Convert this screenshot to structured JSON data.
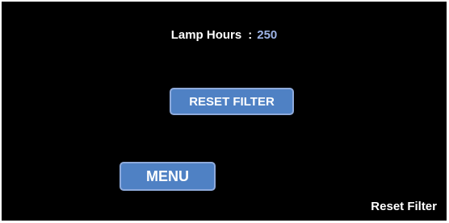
{
  "status": {
    "lamp_hours_label": "Lamp Hours",
    "separator": ":",
    "lamp_hours_value": "250"
  },
  "buttons": {
    "reset_filter_label": "RESET FILTER",
    "menu_label": "MENU"
  },
  "footer": {
    "screen_title": "Reset Filter"
  },
  "colors": {
    "background": "#000000",
    "button_fill": "#4f81c4",
    "button_border": "#8eaadb",
    "value_text": "#9db3e6",
    "text": "#ffffff"
  }
}
